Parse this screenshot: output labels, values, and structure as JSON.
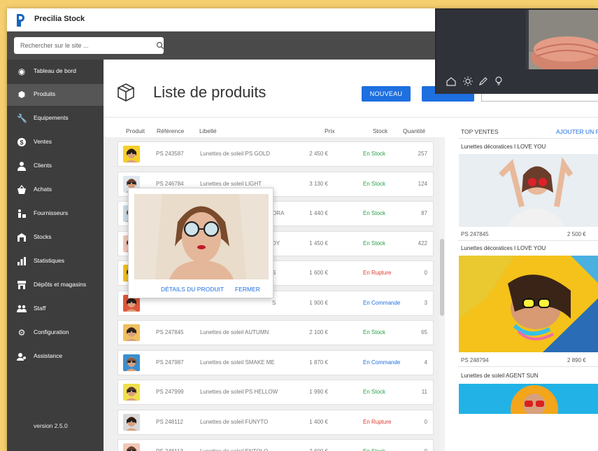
{
  "app": {
    "title": "Precilia Stock",
    "version": "version 2.5.0"
  },
  "search": {
    "placeholder": "Rechercher sur le site ..."
  },
  "sidebar": {
    "items": [
      {
        "label": "Tableau de bord",
        "icon": "dashboard-icon"
      },
      {
        "label": "Produits",
        "icon": "cube-icon",
        "active": true
      },
      {
        "label": "Equipements",
        "icon": "wrench-icon"
      },
      {
        "label": "Ventes",
        "icon": "dollar-icon"
      },
      {
        "label": "Clients",
        "icon": "user-icon"
      },
      {
        "label": "Achats",
        "icon": "basket-icon"
      },
      {
        "label": "Fournisseurs",
        "icon": "supplier-icon"
      },
      {
        "label": "Stocks",
        "icon": "warehouse-icon"
      },
      {
        "label": "Statistiques",
        "icon": "chart-icon"
      },
      {
        "label": "Dépôts et magasins",
        "icon": "store-icon"
      },
      {
        "label": "Staff",
        "icon": "group-icon"
      },
      {
        "label": "Configuration",
        "icon": "cogs-icon"
      },
      {
        "label": "Assistance",
        "icon": "support-icon"
      }
    ]
  },
  "main": {
    "title": "Liste de produits",
    "new_button": "NOUVEAU",
    "columns": [
      "Produit",
      "Référence",
      "Libellé",
      "Prix",
      "Stock",
      "Quantité"
    ],
    "rows": [
      {
        "ref": "PS 243587",
        "label": "Lunettes de soleil PS GOLD",
        "price": "2 450 €",
        "stock": "En Stock",
        "qty": "257"
      },
      {
        "ref": "PS 246784",
        "label": "Lunettes de soleil LIGHT",
        "price": "3 130 €",
        "stock": "En Stock",
        "qty": "124"
      },
      {
        "ref": "",
        "label": "ORA",
        "price": "1 440 €",
        "stock": "En Stock",
        "qty": "87"
      },
      {
        "ref": "",
        "label": "DY",
        "price": "1 450 €",
        "stock": "En Stock",
        "qty": "422"
      },
      {
        "ref": "",
        "label": "S",
        "price": "1 600 €",
        "stock": "En Rupture",
        "qty": "0"
      },
      {
        "ref": "",
        "label": "S",
        "price": "1 900 €",
        "stock": "En Commande",
        "qty": "3"
      },
      {
        "ref": "PS 247845",
        "label": "Lunettes de soleil AUTUMN",
        "price": "2 100 €",
        "stock": "En Stock",
        "qty": "65"
      },
      {
        "ref": "PS 247987",
        "label": "Lunettes de soleil SMAKE ME",
        "price": "1 870 €",
        "stock": "En Commande",
        "qty": "4"
      },
      {
        "ref": "PS 247999",
        "label": "Lunettes de soleil PS HELLOW",
        "price": "1 990 €",
        "stock": "En Stock",
        "qty": "11"
      },
      {
        "ref": "PS 248112",
        "label": "Lunettes de soleil FUNYTO",
        "price": "1 400 €",
        "stock": "En Rupture",
        "qty": "0"
      },
      {
        "ref": "PS 248113",
        "label": "Lunettes de soleil ENTOLO",
        "price": "2 600 €",
        "stock": "En Stock",
        "qty": "0"
      }
    ]
  },
  "popup": {
    "details": "DÉTAILS DU PRODUIT",
    "close": "FERMER"
  },
  "top_sales": {
    "title": "TOP VENTES",
    "add_filter": "AJOUTER UN FILTRE",
    "items": [
      {
        "name": "Lunettes décoratices I LOVE YOU",
        "ref": "PS 247845",
        "price": "2 500 €"
      },
      {
        "name": "Lunettes décoratices I LOVE YOU",
        "ref": "PS 248794",
        "price": "2 890 €"
      },
      {
        "name": "Lunettes de soleil AGENT SUN",
        "ref": "",
        "price": ""
      }
    ]
  },
  "colors": {
    "accent": "#1e6fe0",
    "sidebar": "#3d3d3d",
    "in_stock": "#27a046",
    "out_of_stock": "#e03a2e",
    "on_order": "#1e6fe0",
    "background": "#f5cf6e"
  }
}
